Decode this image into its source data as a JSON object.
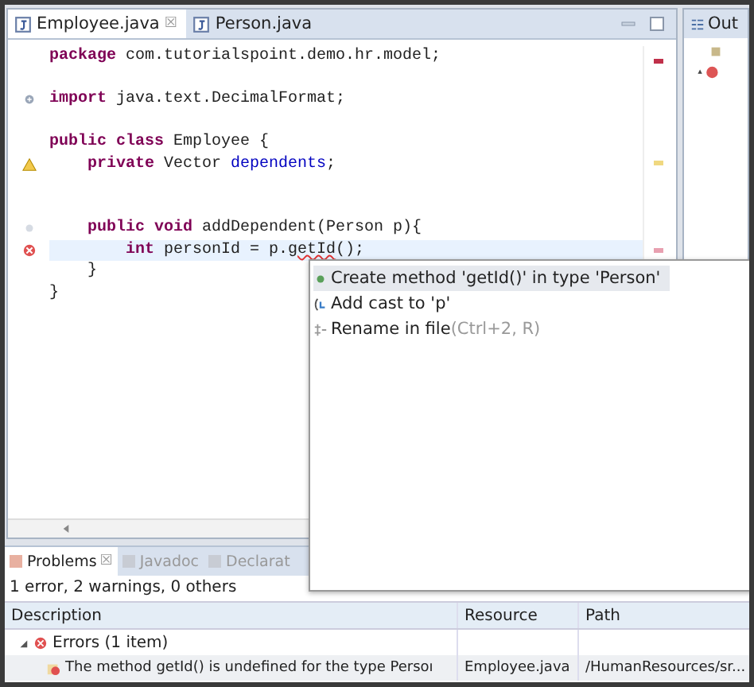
{
  "editor": {
    "tabs": [
      {
        "label": "Employee.java",
        "selected": true,
        "close": "☒"
      },
      {
        "label": "Person.java",
        "selected": false
      }
    ],
    "lines": [
      {
        "kind": "plain",
        "current": false,
        "tokens": [
          {
            "kind": "keyword",
            "text": "package"
          },
          {
            "kind": "plain",
            "text": " com.tutorialspoint.demo.hr.model;"
          }
        ]
      },
      {
        "kind": "plain",
        "current": false
      },
      {
        "kind": "expand",
        "current": false,
        "tokens": [
          {
            "kind": "keyword",
            "text": "import"
          },
          {
            "kind": "plain",
            "text": " java.text.DecimalFormat;"
          }
        ]
      },
      {
        "kind": "plain",
        "current": false
      },
      {
        "kind": "plain",
        "current": false,
        "tokens": [
          {
            "kind": "keyword",
            "text": "public class"
          },
          {
            "kind": "plain",
            "text": " Employee {"
          }
        ]
      },
      {
        "kind": "warning",
        "current": false,
        "tokens": [
          {
            "kind": "keyword",
            "text": "    private"
          },
          {
            "kind": "plain",
            "text": " Vector "
          },
          {
            "kind": "field",
            "text": "dependents"
          },
          {
            "kind": "plain",
            "text": ";"
          }
        ]
      },
      {
        "kind": "plain",
        "current": false
      },
      {
        "kind": "plain",
        "current": false
      },
      {
        "kind": "fold",
        "current": false,
        "tokens": [
          {
            "kind": "keyword",
            "text": "    public void"
          },
          {
            "kind": "plain",
            "text": " addDependent(Person p){"
          }
        ]
      },
      {
        "kind": "error",
        "current": true,
        "tokens": [
          {
            "kind": "keyword",
            "text": "        int"
          },
          {
            "kind": "plain",
            "text": " personId = p."
          },
          {
            "kind": "error",
            "text": "getId"
          },
          {
            "kind": "plain",
            "text": "();"
          }
        ]
      },
      {
        "kind": "plain",
        "current": false,
        "tokens": [
          {
            "kind": "plain",
            "text": "    }"
          }
        ]
      },
      {
        "kind": "plain",
        "current": false,
        "tokens": [
          {
            "kind": "plain",
            "text": "}"
          }
        ]
      }
    ]
  },
  "outline": {
    "tab": "Out"
  },
  "quickfix": [
    {
      "label": "Create method 'getId()' in type 'Person'",
      "selected": true,
      "kind": "method"
    },
    {
      "label": "Add cast to 'p'",
      "selected": false,
      "kind": "cast"
    },
    {
      "label": "Rename in file",
      "shortcut": "(Ctrl+2, R)",
      "selected": false,
      "kind": "rename"
    }
  ],
  "problems": {
    "tabs": [
      {
        "label": "Problems",
        "selected": true,
        "close": "☒"
      },
      {
        "label": "Javadoc",
        "selected": false
      },
      {
        "label": "Declarat",
        "selected": false
      }
    ],
    "summary": "1 error, 2 warnings, 0 others",
    "columns": [
      "Description",
      "Resource",
      "Path"
    ],
    "groups": [
      {
        "label": "Errors (1 item)",
        "expanded": true,
        "children": [
          {
            "description": "The method getId() is undefined for the type Persoı",
            "resource": "Employee.java",
            "path": "/HumanResources/sr..."
          }
        ]
      }
    ]
  }
}
